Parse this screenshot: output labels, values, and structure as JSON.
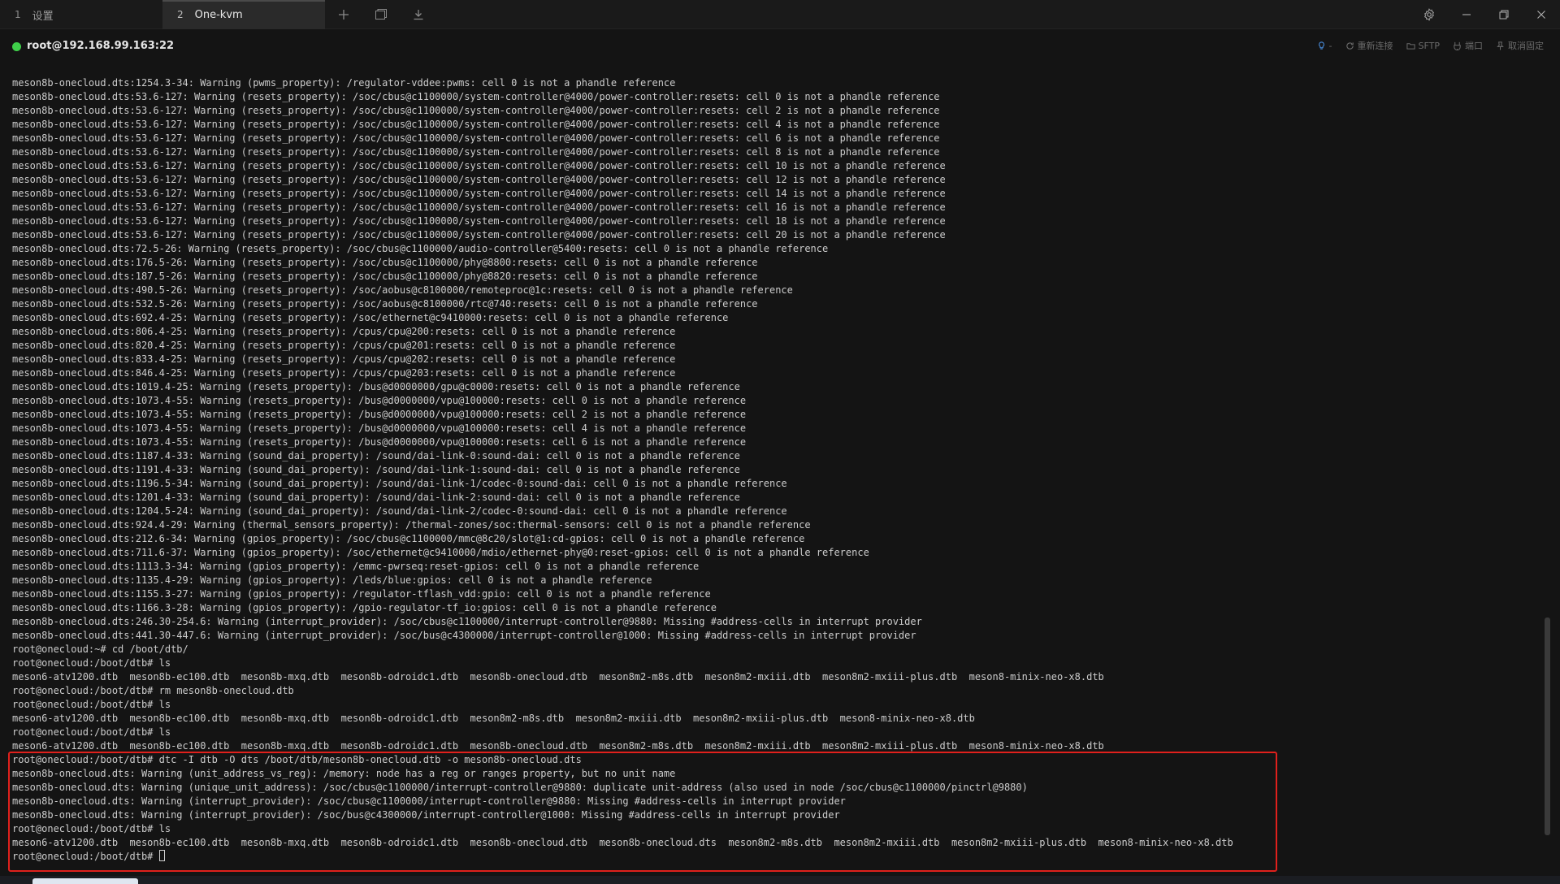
{
  "tabs": [
    {
      "num": "1",
      "label": "设置"
    },
    {
      "num": "2",
      "label": "One-kvm"
    }
  ],
  "session": {
    "host": "root@192.168.99.163:22",
    "actions": [
      {
        "label": "重新连接",
        "icon": "refresh-icon"
      },
      {
        "label": "SFTP",
        "icon": "folder-icon"
      },
      {
        "label": "端口",
        "icon": "port-icon"
      },
      {
        "label": "取消固定",
        "icon": "pin-icon"
      }
    ],
    "bulb_suffix": "-"
  },
  "colors": {
    "status_online": "#3fcf4a",
    "highlight": "#e0201c",
    "terminal_bg": "#141414",
    "terminal_fg": "#cccccc"
  },
  "terminal": {
    "lines": [
      "meson8b-onecloud.dts:1254.3-34: Warning (pwms_property): /regulator-vddee:pwms: cell 0 is not a phandle reference",
      "meson8b-onecloud.dts:53.6-127: Warning (resets_property): /soc/cbus@c1100000/system-controller@4000/power-controller:resets: cell 0 is not a phandle reference",
      "meson8b-onecloud.dts:53.6-127: Warning (resets_property): /soc/cbus@c1100000/system-controller@4000/power-controller:resets: cell 2 is not a phandle reference",
      "meson8b-onecloud.dts:53.6-127: Warning (resets_property): /soc/cbus@c1100000/system-controller@4000/power-controller:resets: cell 4 is not a phandle reference",
      "meson8b-onecloud.dts:53.6-127: Warning (resets_property): /soc/cbus@c1100000/system-controller@4000/power-controller:resets: cell 6 is not a phandle reference",
      "meson8b-onecloud.dts:53.6-127: Warning (resets_property): /soc/cbus@c1100000/system-controller@4000/power-controller:resets: cell 8 is not a phandle reference",
      "meson8b-onecloud.dts:53.6-127: Warning (resets_property): /soc/cbus@c1100000/system-controller@4000/power-controller:resets: cell 10 is not a phandle reference",
      "meson8b-onecloud.dts:53.6-127: Warning (resets_property): /soc/cbus@c1100000/system-controller@4000/power-controller:resets: cell 12 is not a phandle reference",
      "meson8b-onecloud.dts:53.6-127: Warning (resets_property): /soc/cbus@c1100000/system-controller@4000/power-controller:resets: cell 14 is not a phandle reference",
      "meson8b-onecloud.dts:53.6-127: Warning (resets_property): /soc/cbus@c1100000/system-controller@4000/power-controller:resets: cell 16 is not a phandle reference",
      "meson8b-onecloud.dts:53.6-127: Warning (resets_property): /soc/cbus@c1100000/system-controller@4000/power-controller:resets: cell 18 is not a phandle reference",
      "meson8b-onecloud.dts:53.6-127: Warning (resets_property): /soc/cbus@c1100000/system-controller@4000/power-controller:resets: cell 20 is not a phandle reference",
      "meson8b-onecloud.dts:72.5-26: Warning (resets_property): /soc/cbus@c1100000/audio-controller@5400:resets: cell 0 is not a phandle reference",
      "meson8b-onecloud.dts:176.5-26: Warning (resets_property): /soc/cbus@c1100000/phy@8800:resets: cell 0 is not a phandle reference",
      "meson8b-onecloud.dts:187.5-26: Warning (resets_property): /soc/cbus@c1100000/phy@8820:resets: cell 0 is not a phandle reference",
      "meson8b-onecloud.dts:490.5-26: Warning (resets_property): /soc/aobus@c8100000/remoteproc@1c:resets: cell 0 is not a phandle reference",
      "meson8b-onecloud.dts:532.5-26: Warning (resets_property): /soc/aobus@c8100000/rtc@740:resets: cell 0 is not a phandle reference",
      "meson8b-onecloud.dts:692.4-25: Warning (resets_property): /soc/ethernet@c9410000:resets: cell 0 is not a phandle reference",
      "meson8b-onecloud.dts:806.4-25: Warning (resets_property): /cpus/cpu@200:resets: cell 0 is not a phandle reference",
      "meson8b-onecloud.dts:820.4-25: Warning (resets_property): /cpus/cpu@201:resets: cell 0 is not a phandle reference",
      "meson8b-onecloud.dts:833.4-25: Warning (resets_property): /cpus/cpu@202:resets: cell 0 is not a phandle reference",
      "meson8b-onecloud.dts:846.4-25: Warning (resets_property): /cpus/cpu@203:resets: cell 0 is not a phandle reference",
      "meson8b-onecloud.dts:1019.4-25: Warning (resets_property): /bus@d0000000/gpu@c0000:resets: cell 0 is not a phandle reference",
      "meson8b-onecloud.dts:1073.4-55: Warning (resets_property): /bus@d0000000/vpu@100000:resets: cell 0 is not a phandle reference",
      "meson8b-onecloud.dts:1073.4-55: Warning (resets_property): /bus@d0000000/vpu@100000:resets: cell 2 is not a phandle reference",
      "meson8b-onecloud.dts:1073.4-55: Warning (resets_property): /bus@d0000000/vpu@100000:resets: cell 4 is not a phandle reference",
      "meson8b-onecloud.dts:1073.4-55: Warning (resets_property): /bus@d0000000/vpu@100000:resets: cell 6 is not a phandle reference",
      "meson8b-onecloud.dts:1187.4-33: Warning (sound_dai_property): /sound/dai-link-0:sound-dai: cell 0 is not a phandle reference",
      "meson8b-onecloud.dts:1191.4-33: Warning (sound_dai_property): /sound/dai-link-1:sound-dai: cell 0 is not a phandle reference",
      "meson8b-onecloud.dts:1196.5-34: Warning (sound_dai_property): /sound/dai-link-1/codec-0:sound-dai: cell 0 is not a phandle reference",
      "meson8b-onecloud.dts:1201.4-33: Warning (sound_dai_property): /sound/dai-link-2:sound-dai: cell 0 is not a phandle reference",
      "meson8b-onecloud.dts:1204.5-24: Warning (sound_dai_property): /sound/dai-link-2/codec-0:sound-dai: cell 0 is not a phandle reference",
      "meson8b-onecloud.dts:924.4-29: Warning (thermal_sensors_property): /thermal-zones/soc:thermal-sensors: cell 0 is not a phandle reference",
      "meson8b-onecloud.dts:212.6-34: Warning (gpios_property): /soc/cbus@c1100000/mmc@8c20/slot@1:cd-gpios: cell 0 is not a phandle reference",
      "meson8b-onecloud.dts:711.6-37: Warning (gpios_property): /soc/ethernet@c9410000/mdio/ethernet-phy@0:reset-gpios: cell 0 is not a phandle reference",
      "meson8b-onecloud.dts:1113.3-34: Warning (gpios_property): /emmc-pwrseq:reset-gpios: cell 0 is not a phandle reference",
      "meson8b-onecloud.dts:1135.4-29: Warning (gpios_property): /leds/blue:gpios: cell 0 is not a phandle reference",
      "meson8b-onecloud.dts:1155.3-27: Warning (gpios_property): /regulator-tflash_vdd:gpio: cell 0 is not a phandle reference",
      "meson8b-onecloud.dts:1166.3-28: Warning (gpios_property): /gpio-regulator-tf_io:gpios: cell 0 is not a phandle reference",
      "meson8b-onecloud.dts:246.30-254.6: Warning (interrupt_provider): /soc/cbus@c1100000/interrupt-controller@9880: Missing #address-cells in interrupt provider",
      "meson8b-onecloud.dts:441.30-447.6: Warning (interrupt_provider): /soc/bus@c4300000/interrupt-controller@1000: Missing #address-cells in interrupt provider",
      "root@onecloud:~# cd /boot/dtb/",
      "root@onecloud:/boot/dtb# ls",
      "meson6-atv1200.dtb  meson8b-ec100.dtb  meson8b-mxq.dtb  meson8b-odroidc1.dtb  meson8b-onecloud.dtb  meson8m2-m8s.dtb  meson8m2-mxiii.dtb  meson8m2-mxiii-plus.dtb  meson8-minix-neo-x8.dtb",
      "root@onecloud:/boot/dtb# rm meson8b-onecloud.dtb",
      "root@onecloud:/boot/dtb# ls",
      "meson6-atv1200.dtb  meson8b-ec100.dtb  meson8b-mxq.dtb  meson8b-odroidc1.dtb  meson8m2-m8s.dtb  meson8m2-mxiii.dtb  meson8m2-mxiii-plus.dtb  meson8-minix-neo-x8.dtb",
      "root@onecloud:/boot/dtb# ls",
      "meson6-atv1200.dtb  meson8b-ec100.dtb  meson8b-mxq.dtb  meson8b-odroidc1.dtb  meson8b-onecloud.dtb  meson8m2-m8s.dtb  meson8m2-mxiii.dtb  meson8m2-mxiii-plus.dtb  meson8-minix-neo-x8.dtb",
      "root@onecloud:/boot/dtb# dtc -I dtb -O dts /boot/dtb/meson8b-onecloud.dtb -o meson8b-onecloud.dts",
      "meson8b-onecloud.dts: Warning (unit_address_vs_reg): /memory: node has a reg or ranges property, but no unit name",
      "meson8b-onecloud.dts: Warning (unique_unit_address): /soc/cbus@c1100000/interrupt-controller@9880: duplicate unit-address (also used in node /soc/cbus@c1100000/pinctrl@9880)",
      "meson8b-onecloud.dts: Warning (interrupt_provider): /soc/cbus@c1100000/interrupt-controller@9880: Missing #address-cells in interrupt provider",
      "meson8b-onecloud.dts: Warning (interrupt_provider): /soc/bus@c4300000/interrupt-controller@1000: Missing #address-cells in interrupt provider",
      "root@onecloud:/boot/dtb# ls",
      "meson6-atv1200.dtb  meson8b-ec100.dtb  meson8b-mxq.dtb  meson8b-odroidc1.dtb  meson8b-onecloud.dtb  meson8b-onecloud.dts  meson8m2-m8s.dtb  meson8m2-mxiii.dtb  meson8m2-mxiii-plus.dtb  meson8-minix-neo-x8.dtb"
    ],
    "prompt": "root@onecloud:/boot/dtb# "
  }
}
